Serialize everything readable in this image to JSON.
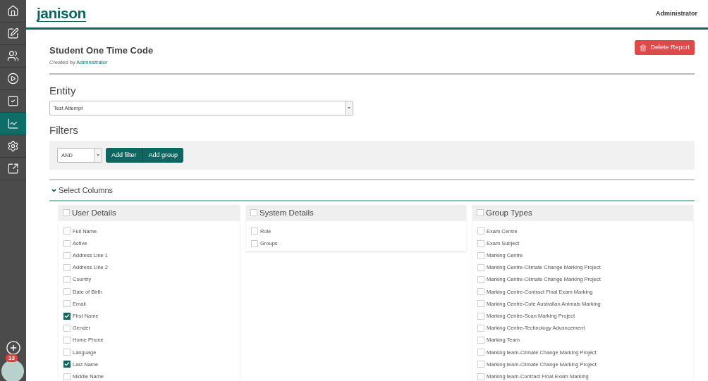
{
  "sidebar": {
    "items": [
      {
        "kind": "home",
        "selected": false
      },
      {
        "kind": "edit",
        "selected": false
      },
      {
        "kind": "people",
        "selected": false
      },
      {
        "kind": "play",
        "selected": false
      },
      {
        "kind": "check",
        "selected": false
      },
      {
        "kind": "chart",
        "selected": true
      },
      {
        "kind": "settings",
        "selected": false
      },
      {
        "kind": "external",
        "selected": false
      }
    ],
    "notification_count": "13"
  },
  "header": {
    "logo": "janison",
    "user": "Administrator"
  },
  "report": {
    "title": "Student One Time Code",
    "created_by_label": "Created by",
    "created_by": "Administrator",
    "delete_button": "Delete Report"
  },
  "entity": {
    "heading": "Entity",
    "value": "Test Attempt"
  },
  "filters": {
    "heading": "Filters",
    "operator": "AND",
    "buttons": [
      "Add filter",
      "Add group"
    ]
  },
  "select_columns": {
    "label": "Select Columns",
    "expanded": true,
    "groups": [
      {
        "title": "User Details",
        "checked": false,
        "items": [
          {
            "label": "Full Name",
            "checked": false
          },
          {
            "label": "Active",
            "checked": false
          },
          {
            "label": "Address Line 1",
            "checked": false
          },
          {
            "label": "Address Line 2",
            "checked": false
          },
          {
            "label": "Country",
            "checked": false
          },
          {
            "label": "Date of Birth",
            "checked": false
          },
          {
            "label": "Email",
            "checked": false
          },
          {
            "label": "First Name",
            "checked": true
          },
          {
            "label": "Gender",
            "checked": false
          },
          {
            "label": "Home Phone",
            "checked": false
          },
          {
            "label": "Language",
            "checked": false
          },
          {
            "label": "Last Name",
            "checked": true
          },
          {
            "label": "Middle Name",
            "checked": false
          }
        ]
      },
      {
        "title": "System Details",
        "checked": false,
        "items": [
          {
            "label": "Role",
            "checked": false
          },
          {
            "label": "Groups",
            "checked": false
          }
        ]
      },
      {
        "title": "Group Types",
        "checked": false,
        "items": [
          {
            "label": "Exam Centre",
            "checked": false
          },
          {
            "label": "Exam Subject",
            "checked": false
          },
          {
            "label": "Marking Centre",
            "checked": false
          },
          {
            "label": "Marking Centre-Climate Change Marking Project",
            "checked": false
          },
          {
            "label": "Marking Centre-Climate Change Marking Project",
            "checked": false
          },
          {
            "label": "Marking Centre-Contract Final Exam Marking",
            "checked": false
          },
          {
            "label": "Marking Centre-Cute Australian Animals Marking",
            "checked": false
          },
          {
            "label": "Marking Centre-Scan Marking Project",
            "checked": false
          },
          {
            "label": "Marking Centre-Technology Advancement",
            "checked": false
          },
          {
            "label": "Marking Team",
            "checked": false
          },
          {
            "label": "Marking team-Climate Change Marking Project",
            "checked": false
          },
          {
            "label": "Marking team-Climate Change Marking Project",
            "checked": false
          },
          {
            "label": "Marking team-Contract Final Exam Marking",
            "checked": false
          }
        ]
      }
    ]
  }
}
